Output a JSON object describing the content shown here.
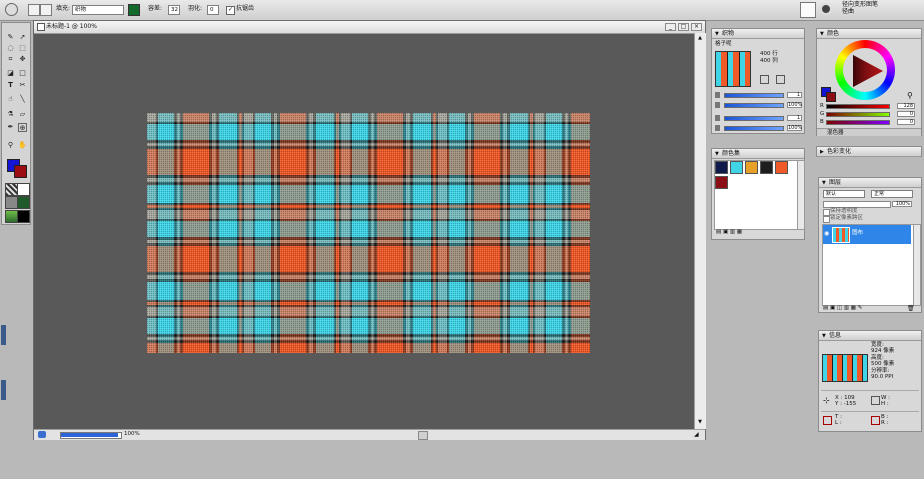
{
  "options_bar": {
    "fill_label": "填充:",
    "fill_value": "织物",
    "tolerance_label": "容差:",
    "tolerance_value": "32",
    "feather_label": "羽化:",
    "feather_value": "0",
    "antialias_label": "抗锯齿",
    "antialias_checked": true,
    "right_title": "径向变形图笔",
    "right_sub": "径曲"
  },
  "toolbox": {
    "tools": [
      "brush-icon",
      "select-arrow-icon",
      "lasso-icon",
      "rect-select-icon",
      "crop-icon",
      "move-icon",
      "fill-bucket-icon",
      "shape-icon",
      "text-icon",
      "transform-icon",
      "smudge-icon",
      "line-icon",
      "eyedropper-icon",
      "eraser-icon",
      "dropper-icon",
      "clone-icon",
      "zoom-icon",
      "hand-icon"
    ],
    "fg_color": "#1414d2",
    "bg_color": "#9b0d12"
  },
  "document": {
    "title": "未标题-1 @ 100%",
    "zoom": "100%",
    "fabric_colors": {
      "red": "#f05a28",
      "cyan": "#3fd4e6",
      "gray": "#a8a79e",
      "dark": "#1e1e1e",
      "line": "#3a3a3a"
    }
  },
  "fabric_panel": {
    "title": "织物",
    "pattern_name": "格子呢",
    "rows": "400 行",
    "cols": "400 列",
    "values": [
      "1",
      "100%",
      "1",
      "100%"
    ],
    "slider_levels": [
      0.05,
      1.0,
      0.05,
      1.0
    ]
  },
  "swatch_panel": {
    "title": "颜色集",
    "swatches": [
      "#0d1a4a",
      "#3fd4e6",
      "#e6a126",
      "#1e1e1e",
      "#f05a28",
      "#8b0f14"
    ]
  },
  "color_panel": {
    "title": "颜色",
    "r_label": "R",
    "g_label": "G",
    "b_label": "B",
    "r_value": "128",
    "g_value": "0",
    "b_value": "0",
    "r_level": 0.5,
    "g_level": 0,
    "b_level": 0,
    "mixer_label": "混色器"
  },
  "color_change_panel": {
    "title": "色彩变化"
  },
  "layers_panel": {
    "title": "图层",
    "blend_mode": "默认",
    "opacity_mode": "正常",
    "opacity_value": "100%",
    "keep_transparency": "保持透明度",
    "lock_label": "锁定像素跨区",
    "layer_name": "图布"
  },
  "info_panel": {
    "title": "信息",
    "width_label": "宽度:",
    "width_value": "924 像素",
    "height_label": "高度:",
    "height_value": "500 像素",
    "res_label": "分辨率:",
    "res_value": "90.0 PPI",
    "x_label": "X : 109",
    "y_label": "Y : -155",
    "w_label": "W :",
    "h_label": "H :",
    "t_label": "T :",
    "l_label": "L :",
    "b_label": "B :",
    "r_label": "R :"
  }
}
